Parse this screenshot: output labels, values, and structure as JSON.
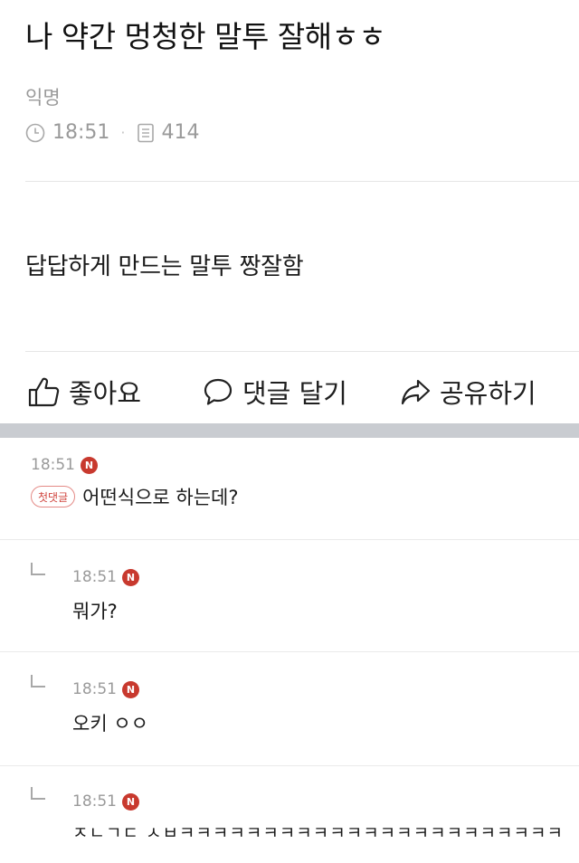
{
  "post": {
    "title": "나 약간 멍청한 말투 잘해ㅎㅎ",
    "author": "익명",
    "time": "18:51",
    "separator": "·",
    "views": "414",
    "body": "답답하게 만드는 말투 짱잘함"
  },
  "actions": {
    "like_label": "좋아요",
    "comment_label": "댓글 달기",
    "share_label": "공유하기"
  },
  "comments": [
    {
      "time": "18:51",
      "badge": "N",
      "first_badge": "첫댓글",
      "text": "어떤식으로 하는데?"
    },
    {
      "time": "18:51",
      "badge": "N",
      "text": "뭐가?"
    },
    {
      "time": "18:51",
      "badge": "N",
      "text": "오키 ㅇㅇ"
    },
    {
      "time": "18:51",
      "badge": "N",
      "text": "ㅈㄴㄱㄷ ㅅㅂㅋㅋㅋㅋㅋㅋㅋㅋㅋㅋㅋㅋㅋㅋㅋㅋㅋㅋㅋㅋㅋㅋㅋ"
    }
  ],
  "colors": {
    "accent_badge": "#c8392e",
    "first_badge_border": "#e48a86",
    "meta_gray": "#9a9a9a"
  },
  "icons": {
    "clock": "clock-icon",
    "views": "document-icon",
    "like": "thumbs-up-icon",
    "comment": "speech-bubble-icon",
    "share": "share-arrow-icon",
    "reply": "reply-corner-icon"
  }
}
